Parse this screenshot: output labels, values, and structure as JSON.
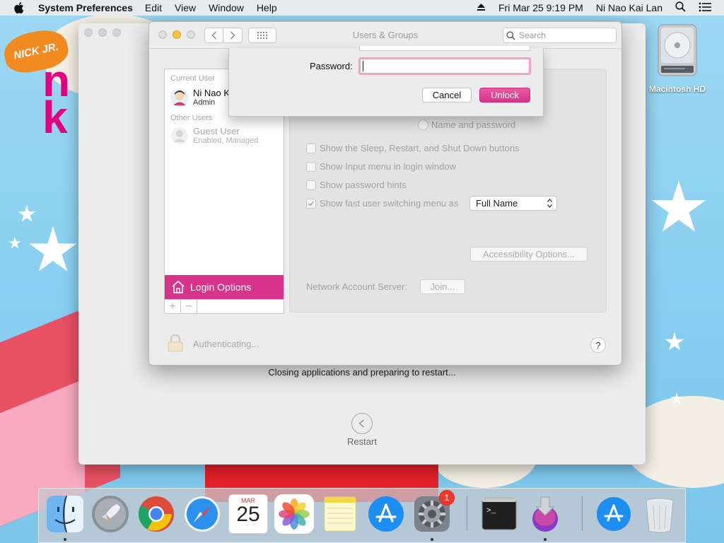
{
  "menubar": {
    "app_name": "System Preferences",
    "menus": [
      "Edit",
      "View",
      "Window",
      "Help"
    ],
    "datetime": "Fri Mar 25  9:19 PM",
    "user_name": "Ni Nao Kai Lan"
  },
  "desktop": {
    "wallpaper_logo": "NICK JR.",
    "hd_label": "Macintosh HD"
  },
  "restart_window": {
    "message": "Closing applications and preparing to restart...",
    "restart_label": "Restart"
  },
  "window": {
    "title": "Users & Groups",
    "search_placeholder": "Search"
  },
  "sidebar": {
    "current_user_header": "Current User",
    "current_user": {
      "name": "Ni Nao Kai Lan",
      "role": "Admin"
    },
    "other_users_header": "Other Users",
    "guest_user": {
      "name": "Guest User",
      "status": "Enabled, Managed"
    },
    "login_options": "Login Options",
    "add_symbol": "+",
    "remove_symbol": "−"
  },
  "panel": {
    "radio_label": "Name and password",
    "checkboxes": [
      {
        "label": "Show the Sleep, Restart, and Shut Down buttons",
        "checked": false
      },
      {
        "label": "Show Input menu in login window",
        "checked": false
      },
      {
        "label": "Show password hints",
        "checked": false
      },
      {
        "label": "Show fast user switching menu as",
        "checked": true
      }
    ],
    "fast_switch_value": "Full Name",
    "accessibility_button": "Accessibility Options...",
    "network_server_label": "Network Account Server:",
    "join_button": "Join..."
  },
  "footer": {
    "auth_status": "Authenticating...",
    "help_symbol": "?"
  },
  "auth_sheet": {
    "password_label": "Password:",
    "password_value": "",
    "cancel_label": "Cancel",
    "unlock_label": "Unlock",
    "accent_color": "#d6338a"
  },
  "dock": {
    "items": [
      "finder",
      "launchpad",
      "chrome",
      "safari",
      "calendar",
      "photos",
      "notes",
      "app-store",
      "system-preferences",
      "terminal",
      "installer",
      "app-store-downloads",
      "trash"
    ],
    "calendar_month": "MAR",
    "calendar_day": "25",
    "sysprefs_badge": "1",
    "terminal_prompt": ">_"
  }
}
